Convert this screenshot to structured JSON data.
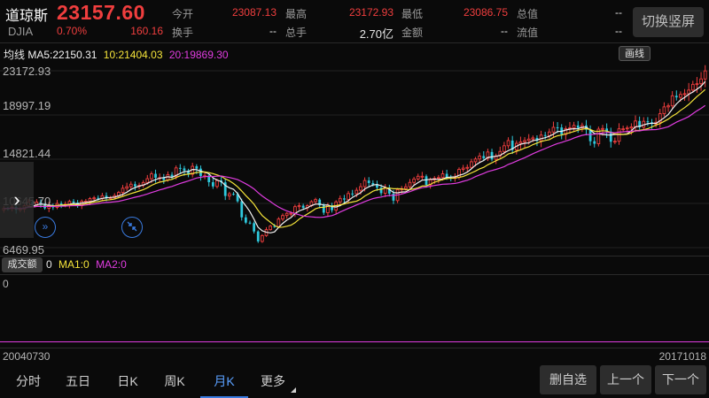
{
  "header": {
    "name": "道琼斯",
    "code": "DJIA",
    "price": "23157.60",
    "pct": "0.70%",
    "change": "160.16",
    "switch_label": "切换竖屏"
  },
  "stats": [
    {
      "label": "今开",
      "value": "23087.13",
      "color": "red"
    },
    {
      "label": "最高",
      "value": "23172.93",
      "color": "red"
    },
    {
      "label": "最低",
      "value": "23086.75",
      "color": "red"
    },
    {
      "label": "总值",
      "value": "--",
      "color": "white"
    },
    {
      "label": "换手",
      "value": "--",
      "color": "white"
    },
    {
      "label": "总手",
      "value": "2.70亿",
      "color": "white"
    },
    {
      "label": "金额",
      "value": "--",
      "color": "white"
    },
    {
      "label": "流值",
      "value": "--",
      "color": "white"
    }
  ],
  "ma_line": {
    "prefix": "均线",
    "ma5": "MA5:22150.31",
    "ma10": "10:21404.03",
    "ma20": "20:19869.30",
    "draw_label": "画线"
  },
  "y_axis": [
    "23172.93",
    "18997.19",
    "14821.44",
    "10645.70",
    "6469.95"
  ],
  "volume": {
    "tag": "成交额",
    "value": "0",
    "ma1": "MA1:0",
    "ma2": "MA2:0",
    "zero_label": "0"
  },
  "dates": {
    "start": "20040730",
    "end": "20171018"
  },
  "tabs": [
    "分时",
    "五日",
    "日K",
    "周K",
    "月K",
    "更多"
  ],
  "active_tab": "月K",
  "buttons": {
    "remove_watch": "删自选",
    "prev": "上一个",
    "next": "下一个"
  },
  "colors": {
    "up": "#f03e3e",
    "down": "#2ec8dc",
    "ma5": "#f2f2f2",
    "ma10": "#f5e43a",
    "ma20": "#e03ce0",
    "accent": "#3a7be0"
  },
  "icons": {
    "fast_forward": "double-chevron-right-icon",
    "collapse": "shrink-arrows-icon",
    "expand": "chevron-right-icon"
  },
  "chart_data": {
    "type": "candlestick",
    "ylim": [
      6469.95,
      23172.93
    ],
    "x_range": [
      "20040730",
      "20171018"
    ],
    "closes": [
      10180,
      10150,
      10310,
      10030,
      10100,
      10430,
      10780,
      10490,
      10770,
      10500,
      10190,
      10470,
      10270,
      10640,
      10480,
      10570,
      10830,
      10720,
      10440,
      10860,
      10860,
      11100,
      11170,
      11110,
      11370,
      11170,
      11190,
      11380,
      11680,
      12080,
      12220,
      12460,
      12260,
      12350,
      12620,
      12980,
      13440,
      13070,
      13070,
      12850,
      13360,
      13190,
      14000,
      13950,
      13750,
      13400,
      14150,
      13930,
      13240,
      13260,
      12650,
      12250,
      12810,
      12640,
      11350,
      11550,
      11540,
      10850,
      9330,
      8830,
      8780,
      8000,
      7060,
      7610,
      8170,
      8500,
      8450,
      9170,
      9500,
      9710,
      9710,
      10340,
      10430,
      10230,
      10430,
      10810,
      11010,
      10460,
      9770,
      10470,
      10010,
      10790,
      11120,
      11010,
      11580,
      11570,
      11890,
      12230,
      12810,
      12570,
      12410,
      12140,
      11610,
      12140,
      11570,
      10910,
      11950,
      12040,
      12220,
      12630,
      12950,
      13210,
      13210,
      12390,
      12880,
      13010,
      13090,
      13440,
      13090,
      13030,
      13100,
      13860,
      13980,
      14050,
      14580,
      14840,
      15120,
      14910,
      15500,
      14810,
      15130,
      15550,
      16090,
      16580,
      15700,
      16320,
      16460,
      16580,
      16720,
      16830,
      16560,
      17100,
      17040,
      17390,
      17830,
      17820,
      17160,
      17700,
      17780,
      18010,
      17780,
      18010,
      17610,
      16520,
      16280,
      17660,
      17720,
      17430,
      16470,
      16520,
      17690,
      17690,
      17770,
      17870,
      18430,
      17840,
      18400,
      18310,
      18140,
      18310,
      19120,
      19760,
      19860,
      20810,
      20660,
      20940,
      21010,
      21350,
      21890,
      21950,
      22400,
      23160
    ],
    "ma_series": [
      "MA5",
      "MA10",
      "MA20"
    ],
    "ma_values": {
      "MA5": 22150.31,
      "MA10": 21404.03,
      "MA20": 19869.3
    }
  }
}
